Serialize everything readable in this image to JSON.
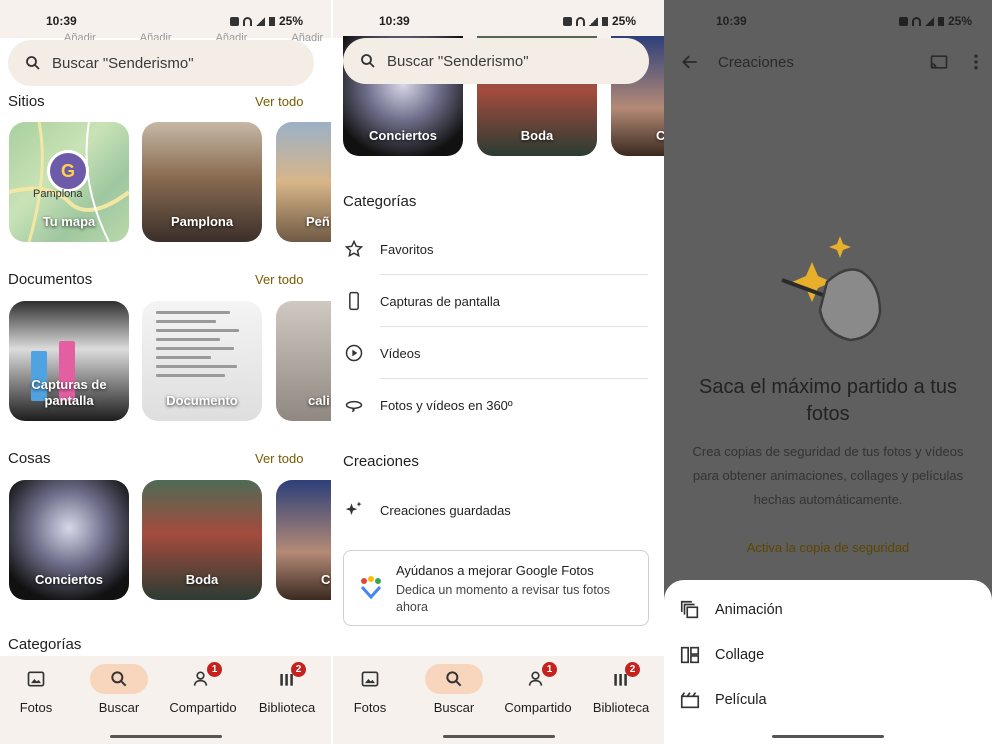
{
  "status": {
    "time": "10:39",
    "battery": "25%"
  },
  "panel1": {
    "search_placeholder": "Buscar \"Senderismo\"",
    "top_faded": [
      "Añadir",
      "Añadir",
      "Añadir",
      "Añadir"
    ],
    "sections": {
      "sitios": {
        "title": "Sitios",
        "see_all": "Ver todo",
        "items": [
          "Tu mapa",
          "Pamplona",
          "Peñ"
        ]
      },
      "documentos": {
        "title": "Documentos",
        "see_all": "Ver todo",
        "items": [
          "Capturas de pantalla",
          "Documento",
          "cali"
        ]
      },
      "cosas": {
        "title": "Cosas",
        "see_all": "Ver todo",
        "items": [
          "Conciertos",
          "Boda",
          "C"
        ]
      },
      "categorias": {
        "title": "Categorías"
      }
    },
    "map_label": "Pamplona",
    "map_pin": "G"
  },
  "panel2": {
    "search_placeholder": "Buscar \"Senderismo\"",
    "top_tiles": [
      "Conciertos",
      "Boda",
      "C"
    ],
    "categories_title": "Categorías",
    "categories": [
      "Favoritos",
      "Capturas de pantalla",
      "Vídeos",
      "Fotos y vídeos en 360º"
    ],
    "creations_title": "Creaciones",
    "creations": [
      "Creaciones guardadas"
    ],
    "card": {
      "title": "Ayúdanos a mejorar Google Fotos",
      "desc": "Dedica un momento a revisar tus fotos ahora"
    }
  },
  "nav": {
    "items": [
      {
        "label": "Fotos",
        "icon": "photo-icon"
      },
      {
        "label": "Buscar",
        "icon": "search-icon",
        "active": true
      },
      {
        "label": "Compartido",
        "icon": "people-icon",
        "badge": "1"
      },
      {
        "label": "Biblioteca",
        "icon": "library-icon",
        "badge": "2"
      }
    ]
  },
  "panel3": {
    "title": "Creaciones",
    "hero_title": "Saca el máximo partido a tus fotos",
    "hero_desc": "Crea copias de seguridad de tus fotos y vídeos para obtener animaciones, collages y películas hechas automáticamente.",
    "hero_link": "Activa la copia de seguridad",
    "sheet_items": [
      "Animación",
      "Collage",
      "Película"
    ]
  },
  "colors": {
    "accent": "#7a5b00",
    "active_pill": "#f8d6bd",
    "badge": "#c5221f",
    "nav_bg": "#f6f1ec"
  }
}
